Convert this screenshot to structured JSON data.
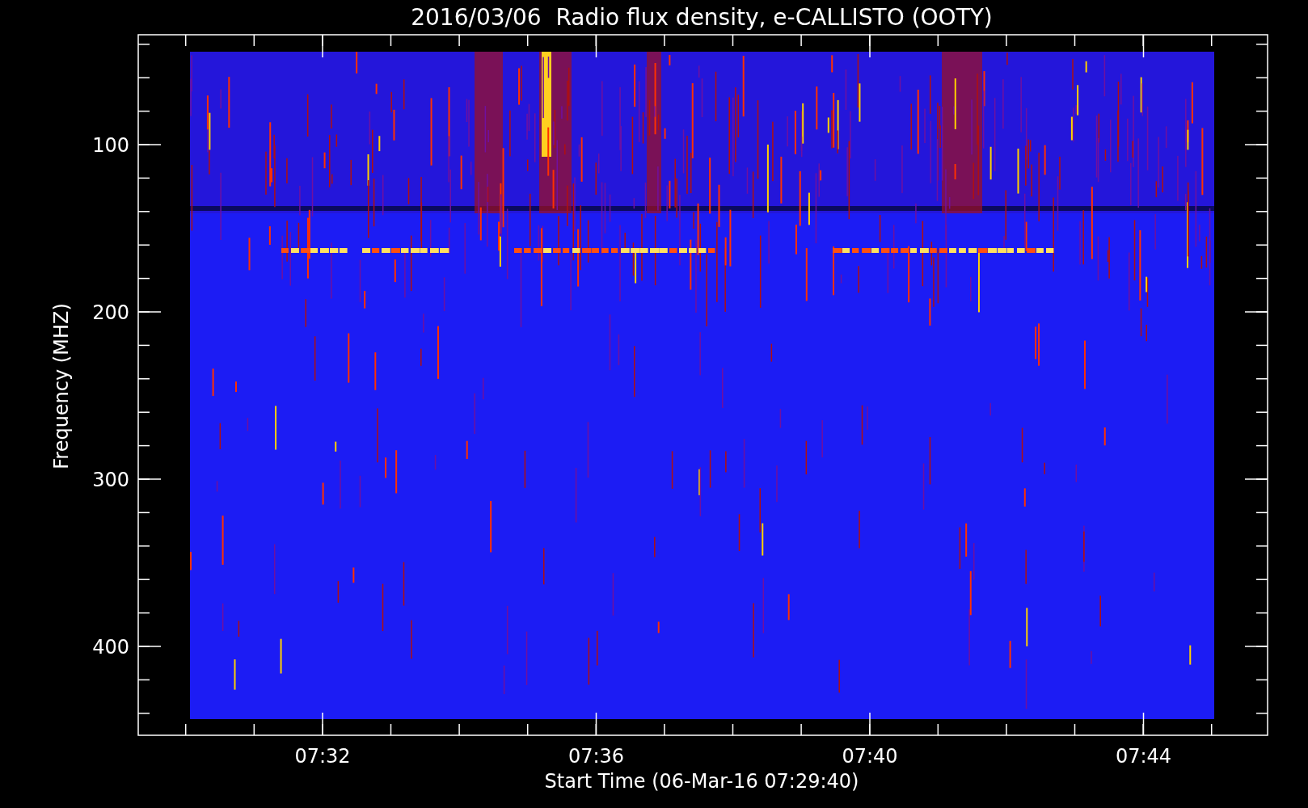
{
  "title": "2016/03/06  Radio flux density, e-CALLISTO (OOTY)",
  "y_axis": {
    "label": "Frequency (MHZ)",
    "ticks": [
      "100",
      "200",
      "300",
      "400"
    ]
  },
  "x_axis": {
    "label": "Start Time (06-Mar-16 07:29:40)",
    "ticks": [
      "07:32",
      "07:36",
      "07:40",
      "07:44"
    ]
  }
}
